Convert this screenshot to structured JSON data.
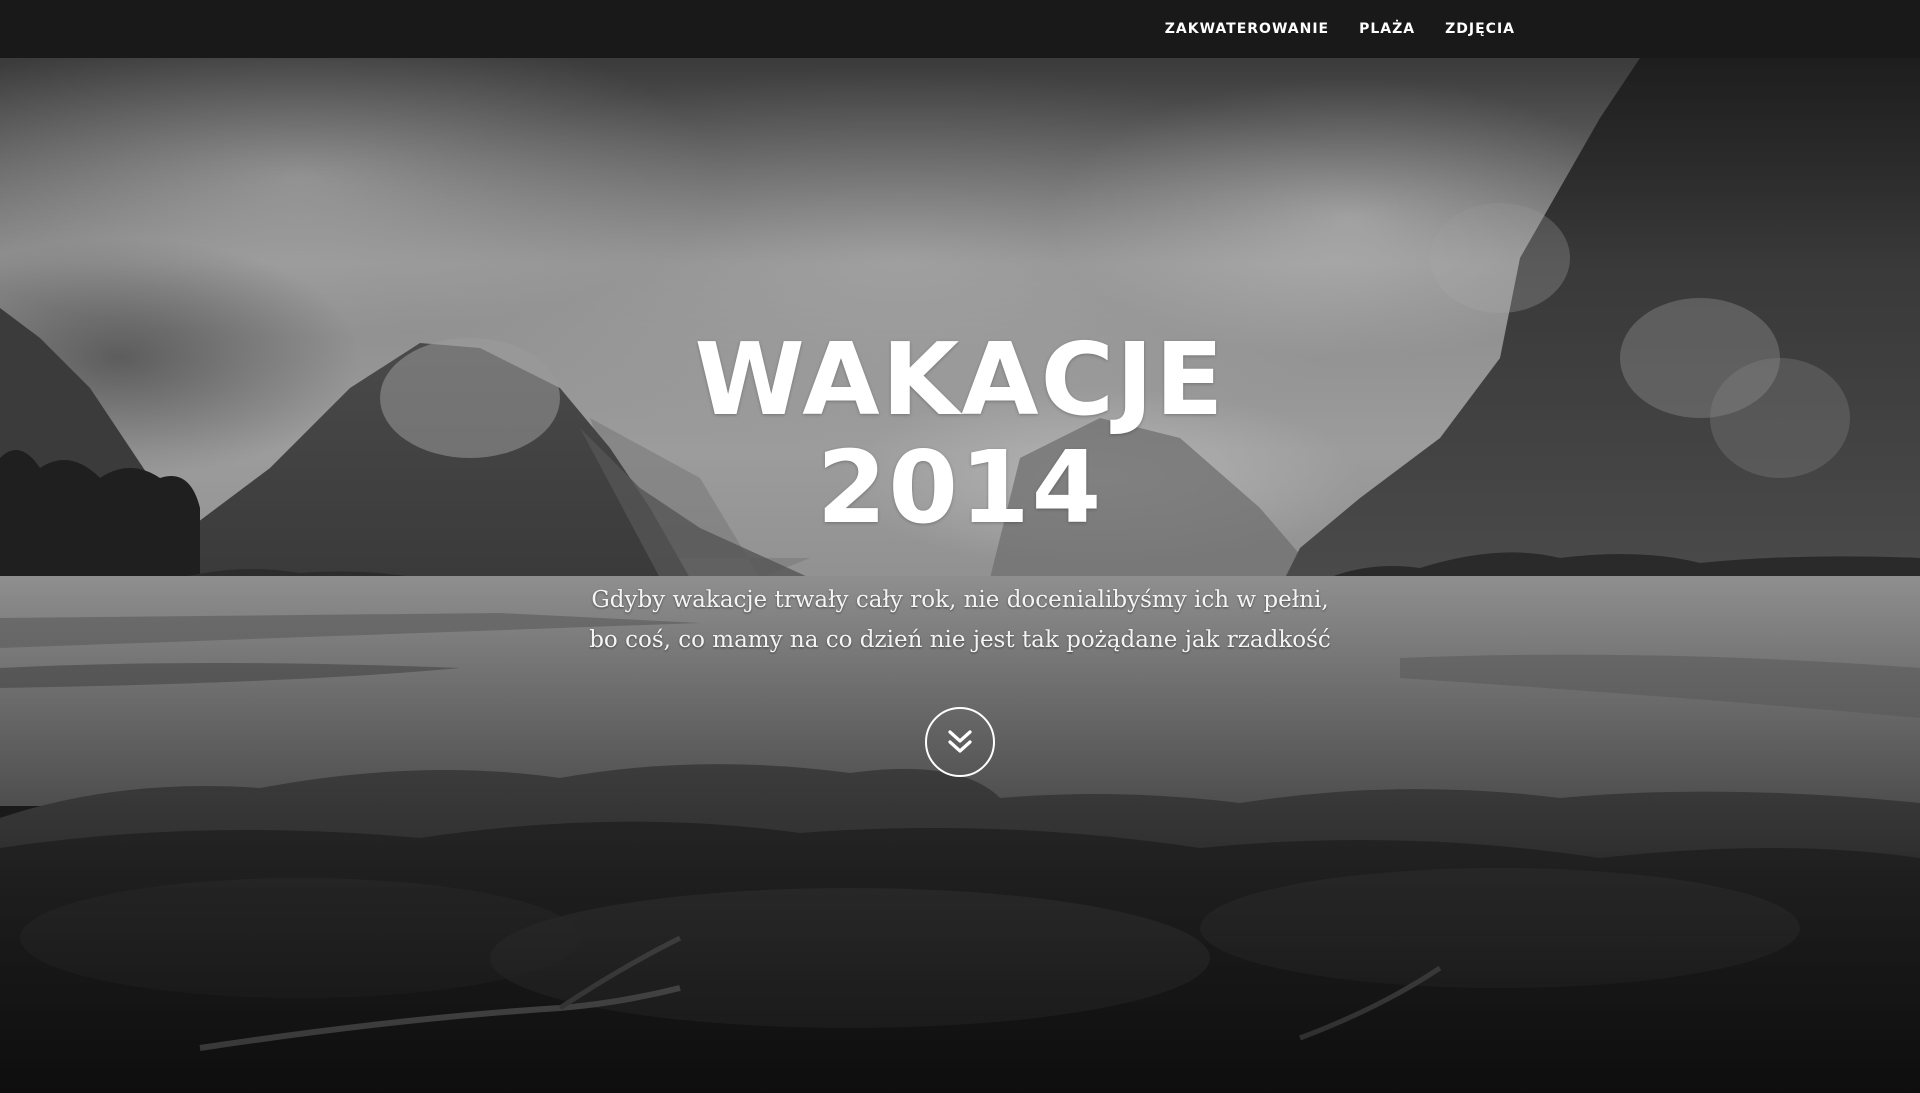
{
  "nav": {
    "items": [
      {
        "label": "ZAKWATEROWANIE"
      },
      {
        "label": "PLAŻA"
      },
      {
        "label": "ZDJĘCIA"
      }
    ]
  },
  "hero": {
    "title_line1": "WAKACJE",
    "title_line2": "2014",
    "subtitle_line1": "Gdyby wakacje trwały cały rok, nie docenialibyśmy ich w pełni,",
    "subtitle_line2": "bo coś, co mamy na co dzień nie jest tak pożądane jak rzadkość",
    "scroll_icon": "double-chevron-down-icon",
    "background_image": "black-and-white landscape with misty mountains, lake and grassy shore"
  },
  "colors": {
    "navbar_bg": "#191919",
    "text": "#ffffff"
  }
}
